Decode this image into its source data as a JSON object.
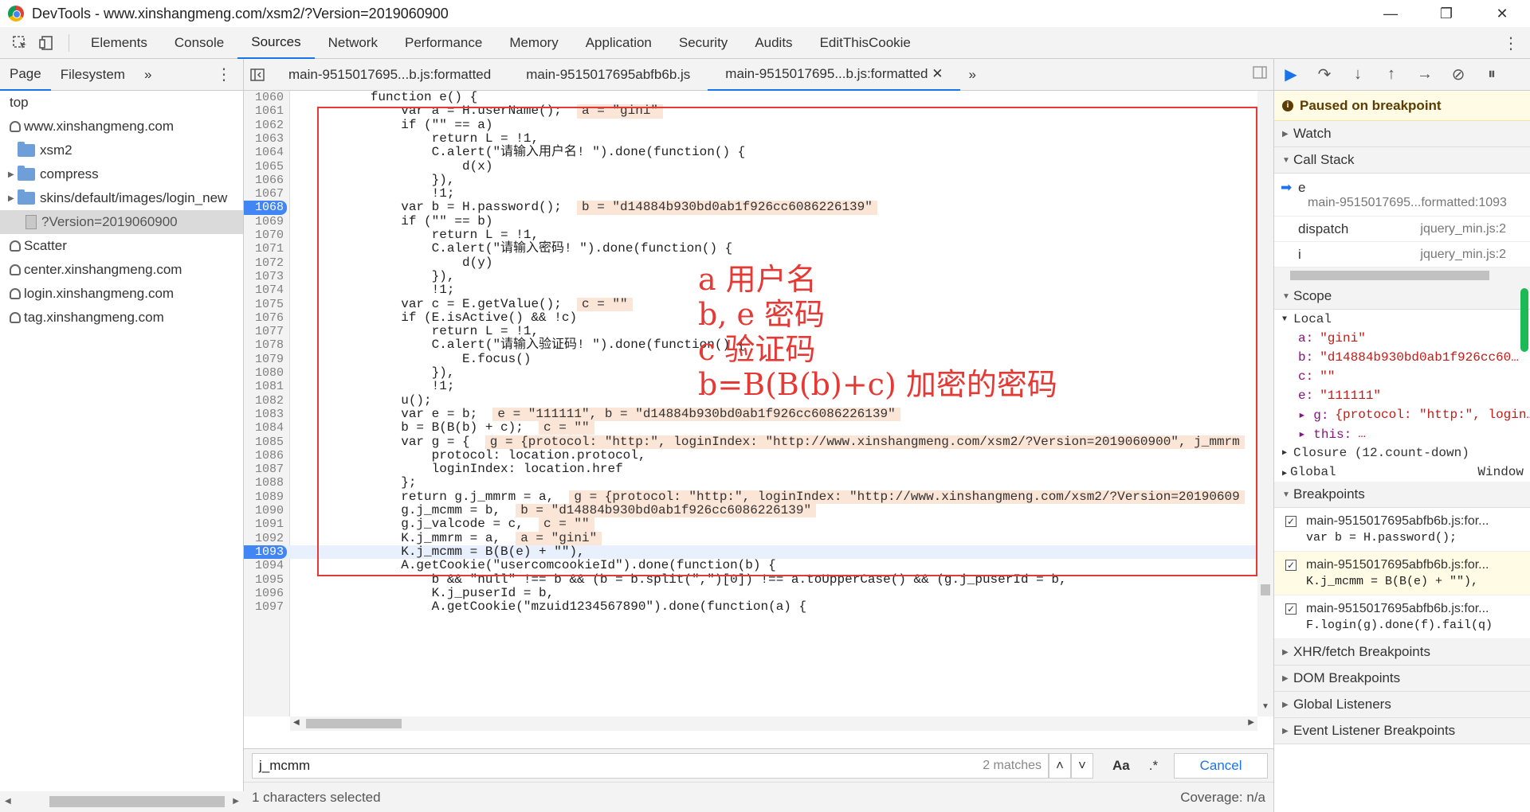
{
  "window": {
    "title": "DevTools - www.xinshangmeng.com/xsm2/?Version=2019060900",
    "minimize": "—",
    "restore": "❐",
    "close": "✕"
  },
  "main_tabs": [
    "Elements",
    "Console",
    "Sources",
    "Network",
    "Performance",
    "Memory",
    "Application",
    "Security",
    "Audits",
    "EditThisCookie"
  ],
  "active_main_tab": "Sources",
  "navigator": {
    "tabs": [
      "Page",
      "Filesystem",
      "»"
    ],
    "tree": [
      {
        "label": "top",
        "indent": 0,
        "icon": "none"
      },
      {
        "label": "www.xinshangmeng.com",
        "indent": 0,
        "icon": "cloud"
      },
      {
        "label": "xsm2",
        "indent": 1,
        "icon": "folder"
      },
      {
        "label": "compress",
        "indent": 1,
        "icon": "folder"
      },
      {
        "label": "skins/default/images/login_new",
        "indent": 1,
        "icon": "folder"
      },
      {
        "label": "?Version=2019060900",
        "indent": 2,
        "icon": "file"
      },
      {
        "label": "Scatter",
        "indent": 0,
        "icon": "cloud"
      },
      {
        "label": "center.xinshangmeng.com",
        "indent": 0,
        "icon": "cloud"
      },
      {
        "label": "login.xinshangmeng.com",
        "indent": 0,
        "icon": "cloud"
      },
      {
        "label": "tag.xinshangmeng.com",
        "indent": 0,
        "icon": "cloud"
      }
    ]
  },
  "editor": {
    "file_tabs": [
      "main-9515017695...b.js:formatted",
      "main-9515017695abfb6b.js",
      "main-9515017695...b.js:formatted ✕"
    ],
    "lines": [
      {
        "n": "1060",
        "code": "        function e() {",
        "val": ""
      },
      {
        "n": "1061",
        "code": "            var a = H.userName();",
        "val": "a = \"gini\""
      },
      {
        "n": "1062",
        "code": "            if (\"\" == a)",
        "val": ""
      },
      {
        "n": "1063",
        "code": "                return L = !1,",
        "val": ""
      },
      {
        "n": "1064",
        "code": "                C.alert(\"请输入用户名! \").done(function() {",
        "val": ""
      },
      {
        "n": "1065",
        "code": "                    d(x)",
        "val": ""
      },
      {
        "n": "1066",
        "code": "                }),",
        "val": ""
      },
      {
        "n": "1067",
        "code": "                !1;",
        "val": ""
      },
      {
        "n": "1068",
        "code": "            var b = H.password();",
        "val": "b = \"d14884b930bd0ab1f926cc6086226139\""
      },
      {
        "n": "1069",
        "code": "            if (\"\" == b)",
        "val": ""
      },
      {
        "n": "1070",
        "code": "                return L = !1,",
        "val": ""
      },
      {
        "n": "1071",
        "code": "                C.alert(\"请输入密码! \").done(function() {",
        "val": ""
      },
      {
        "n": "1072",
        "code": "                    d(y)",
        "val": ""
      },
      {
        "n": "1073",
        "code": "                }),",
        "val": ""
      },
      {
        "n": "1074",
        "code": "                !1;",
        "val": ""
      },
      {
        "n": "1075",
        "code": "            var c = E.getValue();",
        "val": "c = \"\""
      },
      {
        "n": "1076",
        "code": "            if (E.isActive() && !c)",
        "val": ""
      },
      {
        "n": "1077",
        "code": "                return L = !1,",
        "val": ""
      },
      {
        "n": "1078",
        "code": "                C.alert(\"请输入验证码! \").done(function() {",
        "val": ""
      },
      {
        "n": "1079",
        "code": "                    E.focus()",
        "val": ""
      },
      {
        "n": "1080",
        "code": "                }),",
        "val": ""
      },
      {
        "n": "1081",
        "code": "                !1;",
        "val": ""
      },
      {
        "n": "1082",
        "code": "            u();",
        "val": ""
      },
      {
        "n": "1083",
        "code": "            var e = b;",
        "val": "e = \"111111\", b = \"d14884b930bd0ab1f926cc6086226139\""
      },
      {
        "n": "1084",
        "code": "            b = B(B(b) + c);",
        "val": "c = \"\""
      },
      {
        "n": "1085",
        "code": "            var g = {",
        "val": "g = {protocol: \"http:\", loginIndex: \"http://www.xinshangmeng.com/xsm2/?Version=2019060900\", j_mmrm"
      },
      {
        "n": "1086",
        "code": "                protocol: location.protocol,",
        "val": ""
      },
      {
        "n": "1087",
        "code": "                loginIndex: location.href",
        "val": ""
      },
      {
        "n": "1088",
        "code": "            };",
        "val": ""
      },
      {
        "n": "1089",
        "code": "            return g.j_mmrm = a,",
        "val": "g = {protocol: \"http:\", loginIndex: \"http://www.xinshangmeng.com/xsm2/?Version=20190609"
      },
      {
        "n": "1090",
        "code": "            g.j_mcmm = b,",
        "val": "b = \"d14884b930bd0ab1f926cc6086226139\""
      },
      {
        "n": "1091",
        "code": "            g.j_valcode = c,",
        "val": "c = \"\""
      },
      {
        "n": "1092",
        "code": "            K.j_mmrm = a,",
        "val": "a = \"gini\""
      },
      {
        "n": "1093",
        "code": "            K.j_mcmm = B(B(e) + \"\"),",
        "val": ""
      },
      {
        "n": "1094",
        "code": "            A.getCookie(\"usercomcookieId\").done(function(b) {",
        "val": ""
      },
      {
        "n": "1095",
        "code": "                b && \"null\" !== b && (b = b.split(\",\")[0]) !== a.toUpperCase() && (g.j_puserId = b,",
        "val": ""
      },
      {
        "n": "1096",
        "code": "                K.j_puserId = b,",
        "val": ""
      },
      {
        "n": "1097",
        "code": "                A.getCookie(\"mzuid1234567890\").done(function(a) {",
        "val": ""
      }
    ],
    "breakpoint_lines": [
      "1068",
      "1093"
    ],
    "current_line": "1093",
    "annotations": [
      "a  用户名",
      "b, e  密码",
      "c  验证码",
      "b=B(B(b)+c)  加密的密码"
    ]
  },
  "search": {
    "query": "j_mcmm",
    "matches": "2 matches",
    "case_label": "Aa",
    "regex_label": ".*",
    "cancel_label": "Cancel",
    "up": "˄",
    "down": "˅"
  },
  "status": {
    "left": "1 characters selected",
    "right": "Coverage: n/a"
  },
  "debugger": {
    "paused_label": "Paused on breakpoint",
    "watch_label": "Watch",
    "callstack_label": "Call Stack",
    "frames": [
      {
        "name": "e",
        "loc": "main-9515017695...formatted:1093"
      },
      {
        "name": "dispatch",
        "loc": "jquery_min.js:2"
      },
      {
        "name": "i",
        "loc": "jquery_min.js:2"
      }
    ],
    "scope_label": "Scope",
    "local_label": "Local",
    "scope_vars": [
      {
        "k": "a:",
        "v": "\"gini\""
      },
      {
        "k": "b:",
        "v": "\"d14884b930bd0ab1f926cc60…"
      },
      {
        "k": "c:",
        "v": "\"\""
      },
      {
        "k": "e:",
        "v": "\"111111\""
      },
      {
        "k": "▸ g:",
        "v": "{protocol: \"http:\", login…"
      },
      {
        "k": "▸ this:",
        "v": "…"
      }
    ],
    "closure_label": "Closure (12.count-down)",
    "global_label": "Global",
    "global_value": "Window",
    "breakpoints_label": "Breakpoints",
    "breakpoints": [
      {
        "file": "main-9515017695abfb6b.js:for...",
        "code": "var b = H.password();",
        "hit": false
      },
      {
        "file": "main-9515017695abfb6b.js:for...",
        "code": "K.j_mcmm = B(B(e) + \"\"),",
        "hit": true
      },
      {
        "file": "main-9515017695abfb6b.js:for...",
        "code": "F.login(g).done(f).fail(q)",
        "hit": false
      }
    ],
    "more_sections": [
      "XHR/fetch Breakpoints",
      "DOM Breakpoints",
      "Global Listeners",
      "Event Listener Breakpoints"
    ]
  },
  "colors": {
    "accent": "#1a73e8",
    "annotation_red": "#e53935",
    "paused_bg": "#fffbe5"
  }
}
